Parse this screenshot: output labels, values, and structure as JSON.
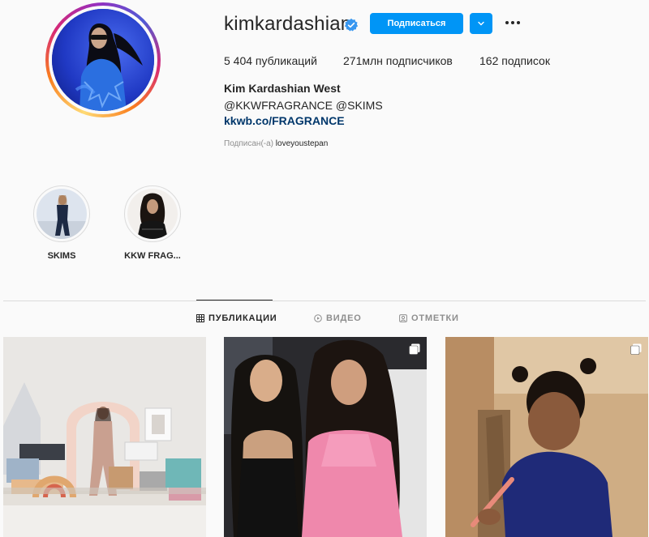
{
  "profile": {
    "username": "kimkardashian",
    "verified": true,
    "follow_label": "Подписаться",
    "stats": {
      "posts": "5 404 публикаций",
      "followers": "271млн подписчиков",
      "following": "162 подписок"
    },
    "bio": {
      "name": "Kim Kardashian West",
      "line": "@KKWFRAGRANCE @SKIMS",
      "link": "kkwb.co/FRAGRANCE"
    },
    "followed_by_prefix": "Подписан(-а)",
    "followed_by_user": "loveyoustepan"
  },
  "highlights": [
    {
      "label": "SKIMS"
    },
    {
      "label": "KKW FRAG..."
    }
  ],
  "tabs": [
    {
      "label": "ПУБЛИКАЦИИ",
      "icon": "grid-icon",
      "active": true
    },
    {
      "label": "ВИДЕО",
      "icon": "video-icon",
      "active": false
    },
    {
      "label": "ОТМЕТКИ",
      "icon": "tagged-icon",
      "active": false
    }
  ],
  "colors": {
    "accent": "#0095f6",
    "link": "#00376b",
    "muted": "#8e8e8e",
    "border": "#dbdbdb",
    "background": "#fafafa"
  }
}
